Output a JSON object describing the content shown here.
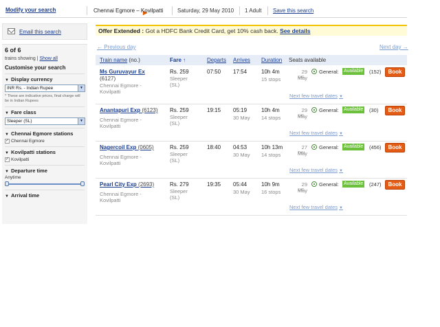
{
  "topbar": {
    "modify_label": "Modify your search",
    "route": "Chennai Egmore – Kovilpatti",
    "date": "Saturday, 29 May 2010",
    "adults": "1 Adult",
    "save_label": "Save this search"
  },
  "sidebar": {
    "email_label": "Email this search",
    "count": "6 of 6",
    "showing": "trains showing |",
    "show_all": "Show all",
    "customise": "Customise your search",
    "currency_title": "Display currency",
    "currency_value": "INR Rs. - Indian Rupee",
    "currency_note": "* These are indicative prices, final charge will be in Indian Rupees",
    "fare_title": "Fare class",
    "fare_value": "Sleeper (SL)",
    "origin_title": "Chennai Egmore stations",
    "origin_station": "Chennai Egmore",
    "dest_title": "Kovilpatti stations",
    "dest_station": "Kovilpatti",
    "departure_title": "Departure time",
    "departure_value": "Anytime",
    "arrival_title": "Arrival time"
  },
  "offer": {
    "bold": "Offer Extended :",
    "text": " Got a HDFC Bank Credit Card, get 10% cash back. ",
    "link": "See details"
  },
  "nav": {
    "prev": "← Previous day",
    "next": "Next day →"
  },
  "table": {
    "headers": {
      "train_name": "Train name",
      "train_no": "(no.)",
      "fare": "Fare",
      "fare_sort": "↑",
      "departs": "Departs",
      "arrives": "Arrives",
      "duration": "Duration",
      "seats": "Seats available"
    },
    "general_label": "General:",
    "available_label": "Available",
    "book_label": "Book",
    "next_few_label": "Next few travel dates",
    "rows": [
      {
        "name": "Ms Guruvayur Ex",
        "number": "(6127)",
        "from": "Chennai Egmore -",
        "to": "Kovilpatti",
        "fare": "Rs. 259",
        "class": "Sleeper",
        "class_code": "(SL)",
        "departs": "07:50",
        "arrives": "17:54",
        "arr_date": "",
        "duration": "10h 4m",
        "stops": "15 stops",
        "seat_date": "29 May",
        "seat_day": "SAT",
        "seats": "(152)"
      },
      {
        "name": "Anantapuri Exp",
        "number": "(6123)",
        "from": "Chennai Egmore -",
        "to": "Kovilpatti",
        "fare": "Rs. 259",
        "class": "Sleeper",
        "class_code": "(SL)",
        "departs": "19:15",
        "arrives": "05:19",
        "arr_date": "30 May",
        "duration": "10h 4m",
        "stops": "14 stops",
        "seat_date": "29 May",
        "seat_day": "SAT",
        "seats": "(30)"
      },
      {
        "name": "Nagercoil Exp",
        "number": "(0605)",
        "from": "Chennai Egmore -",
        "to": "Kovilpatti",
        "fare": "Rs. 259",
        "class": "Sleeper",
        "class_code": "(SL)",
        "departs": "18:40",
        "arrives": "04:53",
        "arr_date": "30 May",
        "duration": "10h 13m",
        "stops": "14 stops",
        "seat_date": "27 May",
        "seat_day": "THU",
        "seats": "(456)"
      },
      {
        "name": "Pearl City Exp",
        "number": "(2693)",
        "from": "Chennai Egmore -",
        "to": "Kovilpatti",
        "fare": "Rs. 279",
        "class": "Sleeper",
        "class_code": "(SL)",
        "departs": "19:35",
        "arrives": "05:44",
        "arr_date": "30 May",
        "duration": "10h 9m",
        "stops": "16 stops",
        "seat_date": "29 May",
        "seat_day": "SAT",
        "seats": "(247)"
      }
    ]
  }
}
